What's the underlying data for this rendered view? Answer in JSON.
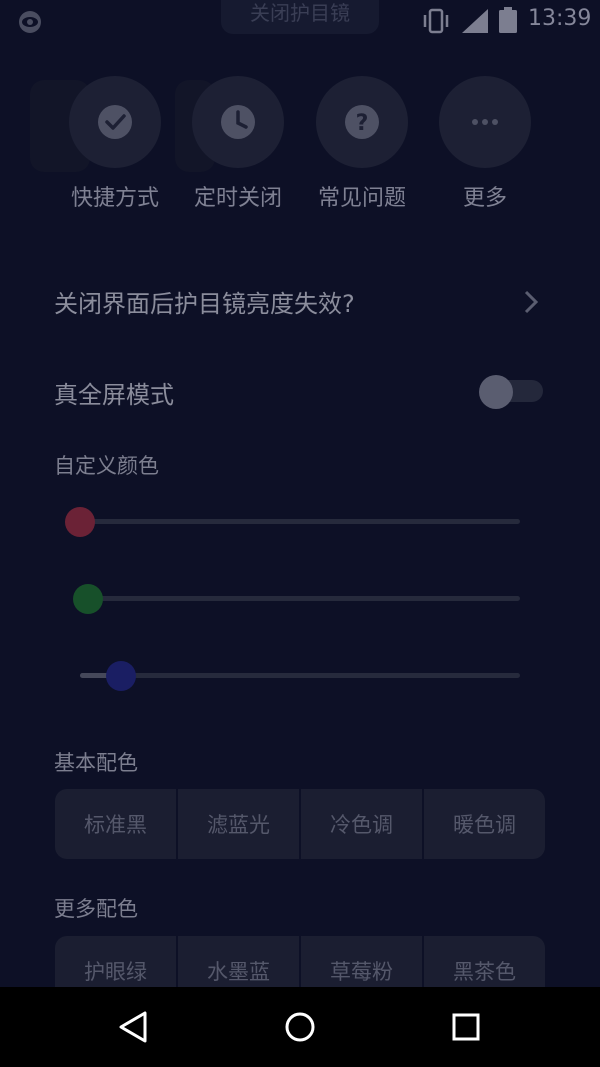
{
  "status_bar": {
    "time": "13:39",
    "top_pill_label": "关闭护目镜",
    "icons": [
      "eye-icon",
      "vibrate-icon",
      "signal-icon",
      "battery-icon"
    ]
  },
  "shortcuts": [
    {
      "label": "快捷方式",
      "icon": "check-icon"
    },
    {
      "label": "定时关闭",
      "icon": "clock-icon"
    },
    {
      "label": "常见问题",
      "icon": "question-icon"
    },
    {
      "label": "更多",
      "icon": "more-icon"
    }
  ],
  "brightness_link": {
    "label": "关闭界面后护目镜亮度失效?"
  },
  "fullscreen": {
    "label": "真全屏模式",
    "enabled": false
  },
  "custom_color": {
    "title": "自定义颜色",
    "sliders": [
      {
        "name": "red",
        "color": "#6b2236",
        "value": 0
      },
      {
        "name": "green",
        "color": "#17502a",
        "value": 0.02
      },
      {
        "name": "blue",
        "color": "#1a1e63",
        "value": 0.09
      }
    ]
  },
  "basic_colors": {
    "title": "基本配色",
    "options": [
      "标准黑",
      "滤蓝光",
      "冷色调",
      "暖色调"
    ]
  },
  "more_colors": {
    "title": "更多配色",
    "options": [
      "护眼绿",
      "水墨蓝",
      "草莓粉",
      "黑茶色"
    ]
  },
  "nav_bar": {
    "icons": [
      "back-icon",
      "home-icon",
      "recents-icon"
    ]
  }
}
